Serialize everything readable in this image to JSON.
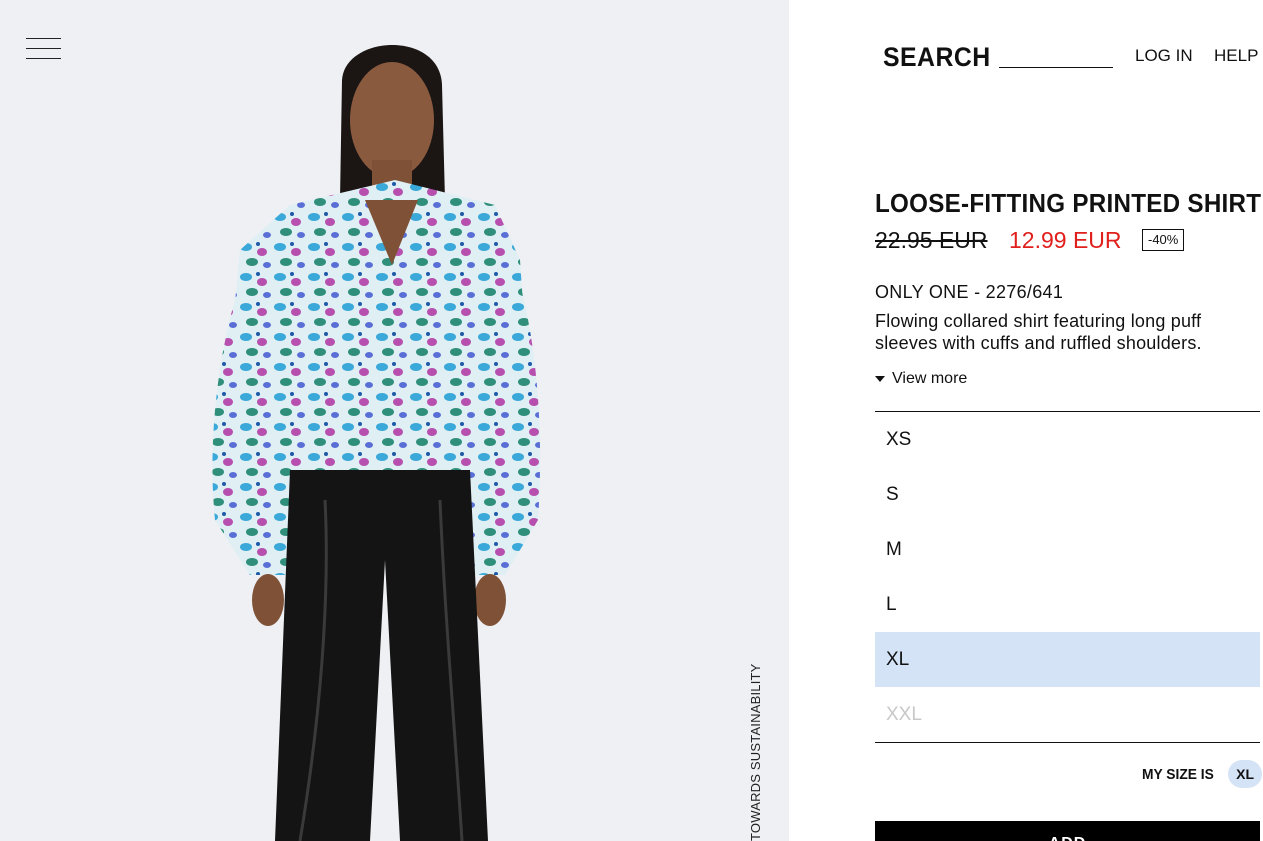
{
  "header": {
    "search_label": "SEARCH",
    "search_value": "",
    "login_label": "LOG IN",
    "help_label": "HELP"
  },
  "image_pane": {
    "menu_icon": "hamburger-menu-icon",
    "side_label": "JOIN LIFE · TOWARDS SUSTAINABILITY",
    "side_label_visible": "TOWARDS SUSTAINABILITY"
  },
  "product": {
    "title": "LOOSE-FITTING PRINTED SHIRT",
    "old_price": "22.95 EUR",
    "new_price": "12.99 EUR",
    "discount": "-40%",
    "reference": "ONLY ONE - 2276/641",
    "description": "Flowing collared shirt featuring long puff sleeves with cuffs and ruffled shoulders.",
    "view_more": "View more"
  },
  "sizes": [
    {
      "label": "XS",
      "state": "available"
    },
    {
      "label": "S",
      "state": "available"
    },
    {
      "label": "M",
      "state": "available"
    },
    {
      "label": "L",
      "state": "available"
    },
    {
      "label": "XL",
      "state": "selected"
    },
    {
      "label": "XXL",
      "state": "disabled"
    }
  ],
  "my_size": {
    "label": "MY SIZE IS",
    "value": "XL"
  },
  "add_button": {
    "label": "ADD"
  },
  "colors": {
    "sale_price": "#e0201c",
    "selected_size_bg": "#d5e3f6",
    "image_bg": "#eef0f4"
  }
}
